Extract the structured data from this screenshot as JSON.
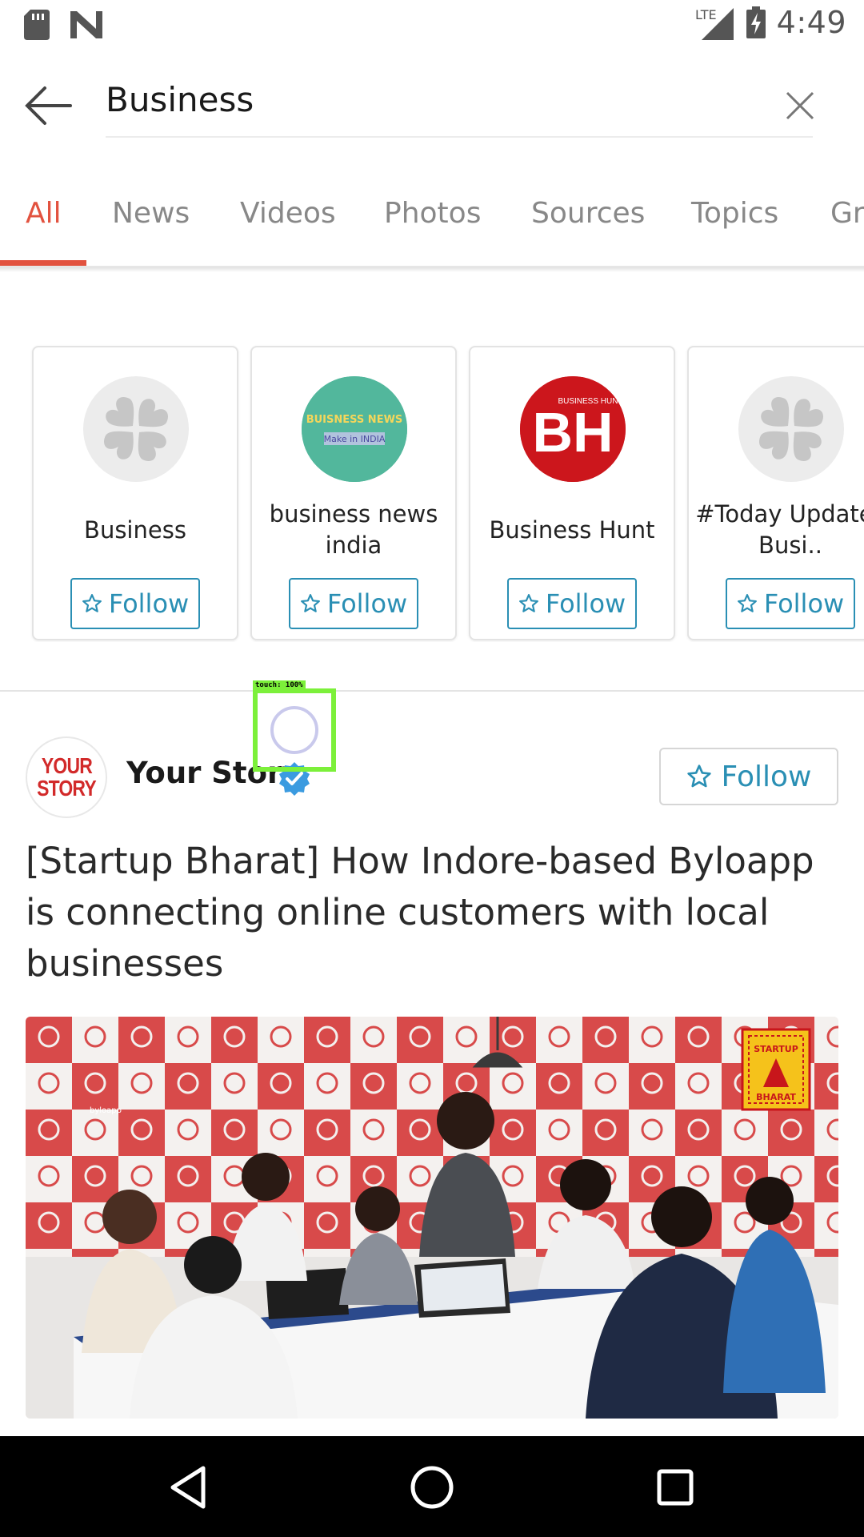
{
  "status_bar": {
    "time": "4:49",
    "network": "LTE",
    "icons": [
      "sd-card-icon",
      "n-logo-icon",
      "signal-icon",
      "battery-charging-icon"
    ]
  },
  "search": {
    "query": "Business",
    "back_icon": "arrow-left-icon",
    "clear_icon": "close-icon"
  },
  "tabs": [
    {
      "label": "All",
      "active": true
    },
    {
      "label": "News"
    },
    {
      "label": "Videos"
    },
    {
      "label": "Photos"
    },
    {
      "label": "Sources"
    },
    {
      "label": "Topics"
    },
    {
      "label": "Gr"
    }
  ],
  "cards": [
    {
      "name": "Business",
      "follow": "Follow",
      "avatar": "placeholder-clover-icon"
    },
    {
      "name": "business news india",
      "follow": "Follow",
      "avatar": "business-news-logo",
      "logo_text_1": "BUISNESS NEWS",
      "logo_text_2": "Make in INDIA"
    },
    {
      "name": "Business Hunt",
      "follow": "Follow",
      "avatar": "business-hunt-logo",
      "logo_text_1": "BH",
      "logo_text_2": "BUSINESS HUNT"
    },
    {
      "name": "#Today Updates Busi..",
      "follow": "Follow",
      "avatar": "placeholder-clover-icon"
    }
  ],
  "article": {
    "source": "Your Story",
    "source_logo_line1": "YOUR",
    "source_logo_line2": "STORY",
    "verified_icon": "verified-badge-icon",
    "follow": "Follow",
    "headline": "[Startup Bharat] How Indore-based Byloapp is connecting online customers with local businesses",
    "image_badge_top": "STARTUP",
    "image_badge_bottom": "BHARAT",
    "image_wall_text": "byloapp"
  },
  "touch_overlay": {
    "label": "touch: 100%"
  },
  "nav_bar": {
    "icons": [
      "back-triangle-icon",
      "home-circle-icon",
      "recents-square-icon"
    ]
  },
  "colors": {
    "accent": "#e2523f",
    "follow_blue": "#2a8fb4"
  }
}
